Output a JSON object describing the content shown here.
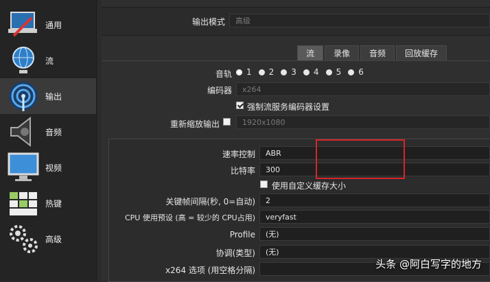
{
  "sidebar": {
    "items": [
      {
        "label": "通用",
        "icon": "settings-laptop-icon"
      },
      {
        "label": "流",
        "icon": "globe-network-icon"
      },
      {
        "label": "输出",
        "icon": "broadcast-icon"
      },
      {
        "label": "音频",
        "icon": "speaker-icon"
      },
      {
        "label": "视频",
        "icon": "monitor-icon"
      },
      {
        "label": "热键",
        "icon": "keyboard-icon"
      },
      {
        "label": "高级",
        "icon": "gears-icon"
      }
    ]
  },
  "output_mode": {
    "label": "输出模式",
    "value": "高级"
  },
  "tabs": [
    "流",
    "录像",
    "音频",
    "回放缓存"
  ],
  "track": {
    "label": "音轨",
    "options": [
      "1",
      "2",
      "3",
      "4",
      "5",
      "6"
    ]
  },
  "encoder": {
    "label": "编码器",
    "value": "x264"
  },
  "enforce_settings": {
    "label": "强制流服务编码器设置"
  },
  "rescale": {
    "label": "重新缩放输出",
    "value": "1920x1080"
  },
  "rate_control": {
    "label": "速率控制",
    "value": "ABR"
  },
  "bitrate": {
    "label": "比特率",
    "value": "300"
  },
  "custom_buffer": {
    "label": "使用自定义缓存大小"
  },
  "keyframe": {
    "label": "关键帧间隔(秒, 0=自动)",
    "value": "2"
  },
  "cpu_preset": {
    "label": "CPU 使用预设 (高 = 较少的 CPU占用)",
    "value": "veryfast"
  },
  "profile": {
    "label": "Profile",
    "value": "(无)"
  },
  "tune": {
    "label": "协调(类型)",
    "value": "(无)"
  },
  "x264_opts": {
    "label": "x264 选项 (用空格分隔)",
    "value": ""
  },
  "watermark": "头条 @阿白写字的地方"
}
